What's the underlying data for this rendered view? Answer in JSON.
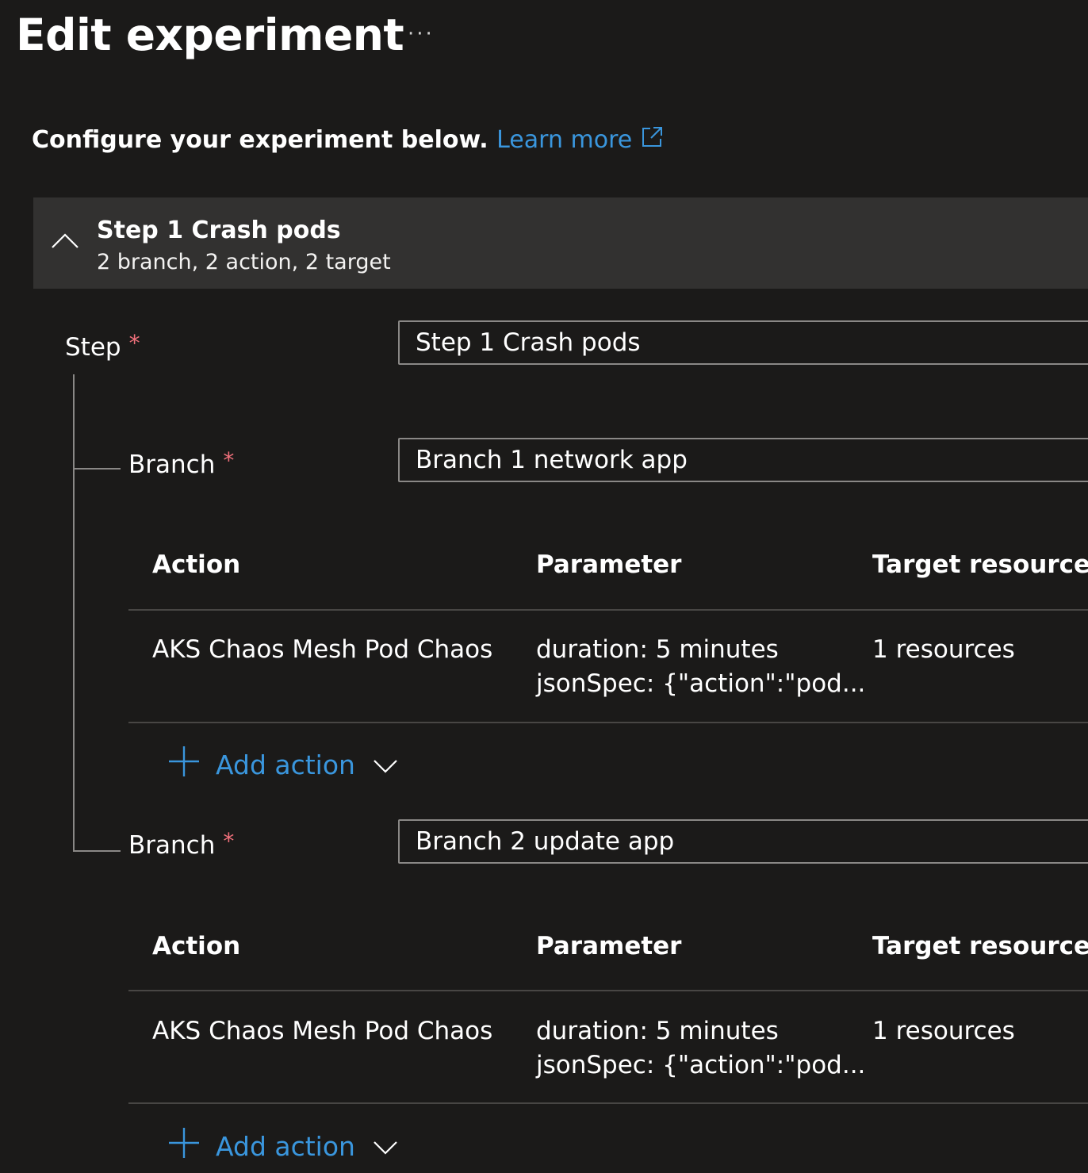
{
  "page": {
    "title": "Edit experiment",
    "more_label": "···",
    "intro_text": "Configure your experiment below.",
    "learn_more": "Learn more"
  },
  "step": {
    "header_title": "Step 1 Crash pods",
    "header_subtitle": "2 branch, 2 action, 2 target",
    "label": "Step",
    "required_mark": "*",
    "value": "Step 1  Crash pods"
  },
  "branches": [
    {
      "label": "Branch",
      "required_mark": "*",
      "value": "Branch 1 network app",
      "columns": [
        "Action",
        "Parameter",
        "Target resources"
      ],
      "rows": [
        {
          "action": "AKS Chaos Mesh Pod Chaos",
          "param_line1": "duration: 5 minutes",
          "param_line2": "jsonSpec: {\"action\":\"pod...",
          "target": "1 resources"
        }
      ],
      "add_action": "Add action"
    },
    {
      "label": "Branch",
      "required_mark": "*",
      "value": "Branch 2 update app",
      "columns": [
        "Action",
        "Parameter",
        "Target resources"
      ],
      "rows": [
        {
          "action": "AKS Chaos Mesh Pod Chaos",
          "param_line1": "duration: 5 minutes",
          "param_line2": "jsonSpec: {\"action\":\"pod...",
          "target": "1 resources"
        }
      ],
      "add_action": "Add action"
    }
  ],
  "colors": {
    "background": "#1b1a19",
    "header_band": "#323130",
    "link": "#3a96dd",
    "required": "#f1707b",
    "border": "#8a8886"
  },
  "icons": {
    "more": "ellipsis-icon",
    "external": "external-link-icon",
    "collapse": "chevron-up-icon",
    "add": "plus-icon",
    "dropdown": "chevron-down-icon"
  }
}
